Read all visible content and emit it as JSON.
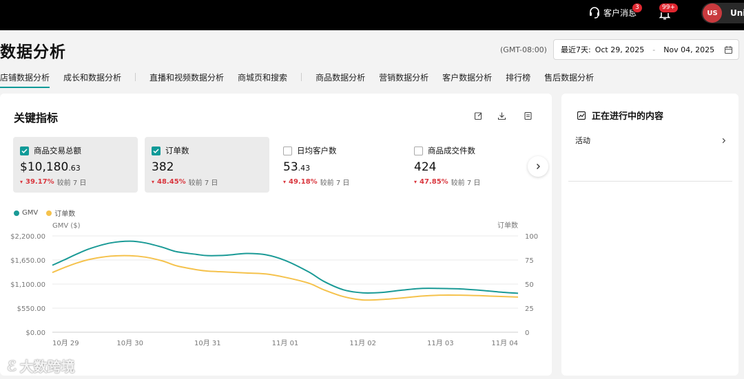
{
  "topbar": {
    "message_label": "客户消息",
    "message_badge": "3",
    "notification_badge": "99+",
    "avatar_initials": "US",
    "user_label": "Unit"
  },
  "page": {
    "title": "数据分析",
    "timezone": "(GMT-08:00)",
    "date_prefix": "最近7天:",
    "date_start": "Oct 29, 2025",
    "date_sep": "-",
    "date_end": "Nov 04, 2025"
  },
  "tabs": [
    {
      "label": "店铺数据分析",
      "active": true
    },
    {
      "label": "成长和数据分析"
    },
    {
      "label": "直播和视频数据分析"
    },
    {
      "label": "商城页和搜索"
    },
    {
      "label": "商品数据分析"
    },
    {
      "label": "营销数据分析"
    },
    {
      "label": "客户数据分析"
    },
    {
      "label": "排行榜"
    },
    {
      "label": "售后数据分析"
    }
  ],
  "key_metrics": {
    "title": "关键指标",
    "items": [
      {
        "label": "商品交易总额",
        "value_main": "$10,180",
        "value_dec": ".63",
        "change": "39.17%",
        "compare": "较前 7 日",
        "checked": true
      },
      {
        "label": "订单数",
        "value_main": "382",
        "value_dec": "",
        "change": "48.45%",
        "compare": "较前 7 日",
        "checked": true
      },
      {
        "label": "日均客户数",
        "value_main": "53",
        "value_dec": ".43",
        "change": "49.18%",
        "compare": "较前 7 日",
        "checked": false
      },
      {
        "label": "商品成交件数",
        "value_main": "424",
        "value_dec": "",
        "change": "47.85%",
        "compare": "较前 7 日",
        "checked": false
      }
    ]
  },
  "colors": {
    "gmv": "#1a9a96",
    "orders": "#f5c24c",
    "accent": "#0f9a98",
    "negative": "#d9363e"
  },
  "chart_data": {
    "type": "line",
    "legend": [
      "GMV",
      "订单数"
    ],
    "y_left_title": "GMV ($)",
    "y_right_title": "订单数",
    "categories": [
      "10月 29",
      "10月 30",
      "10月 31",
      "11月 01",
      "11月 02",
      "11月 03",
      "11月 04"
    ],
    "left_ticks": [
      "$0.00",
      "$550.00",
      "$1,100.00",
      "$1,650.00",
      "$2,200.00"
    ],
    "right_ticks": [
      "0",
      "25",
      "50",
      "75",
      "100"
    ],
    "ylim_left": [
      0,
      2200
    ],
    "ylim_right": [
      0,
      100
    ],
    "series": [
      {
        "name": "GMV",
        "axis": "left",
        "x": [
          0,
          0.15,
          0.32,
          0.5,
          0.75,
          1,
          1.2,
          1.42,
          1.6,
          1.85,
          2,
          2.25,
          2.5,
          2.75,
          3,
          3.3,
          3.5,
          3.75,
          4,
          4.25,
          4.5,
          4.75,
          5,
          5.25,
          5.5,
          5.75,
          6
        ],
        "y": [
          1530,
          1650,
          1790,
          1920,
          2040,
          2080,
          2040,
          1940,
          1840,
          1780,
          1750,
          1760,
          1800,
          1770,
          1640,
          1380,
          1160,
          970,
          900,
          910,
          960,
          1000,
          1000,
          990,
          960,
          920,
          890
        ]
      },
      {
        "name": "订单数",
        "axis": "right",
        "x": [
          0,
          0.15,
          0.32,
          0.5,
          0.75,
          1,
          1.2,
          1.42,
          1.6,
          1.85,
          2,
          2.25,
          2.5,
          2.75,
          3,
          3.3,
          3.5,
          3.75,
          4,
          4.25,
          4.5,
          4.75,
          5,
          5.25,
          5.5,
          5.75,
          6
        ],
        "y": [
          62,
          67,
          72,
          76,
          79,
          79.5,
          78,
          74,
          69,
          65,
          63.5,
          62.5,
          61.5,
          60.5,
          57,
          51,
          44,
          37,
          33.5,
          34,
          35.5,
          37.5,
          38.5,
          38.5,
          38,
          37.2,
          36.5
        ]
      }
    ],
    "grid": "horizontal"
  },
  "side": {
    "title": "正在进行中的内容",
    "item_label": "活动"
  },
  "watermark": {
    "text": "大数跨境"
  }
}
